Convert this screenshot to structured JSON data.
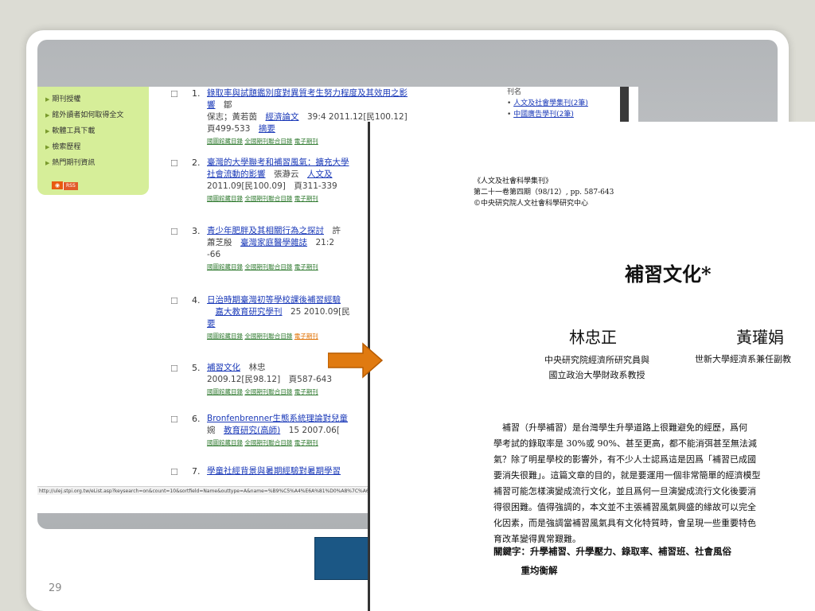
{
  "slide": {
    "page_number": "29"
  },
  "sidebar": {
    "items": [
      "期刊授權",
      "館外讀者如何取得全文",
      "軟體工具下載",
      "檢索歷程",
      "熱門期刊資訊"
    ],
    "rss_label": "RSS"
  },
  "right_col": {
    "heading": "刊名",
    "items": [
      "人文及社會學集刊(2筆)",
      "中國廣告學刊(2筆)"
    ]
  },
  "results": [
    {
      "n": "1.",
      "title": "錄取率與試題鑑別度對異質考生努力程度及其效用之影響",
      "authors_pre": "鄒",
      "authors": "保志；黃若茵",
      "journal": "經濟論文",
      "citation": "39:4 2011.12[民100.12]　頁499-533",
      "summary": "摘要"
    },
    {
      "n": "2.",
      "title": "臺灣的大學聯考和補習風氣：擴充大學",
      "title2": "社會流動的影響",
      "authors": "張瀞云",
      "journal": "人文及",
      "citation": "2011.09[民100.09]　頁311-339"
    },
    {
      "n": "3.",
      "title": "青少年肥胖及其相關行為之探討",
      "authors_pre": "許",
      "authors": "蕭芝殷",
      "journal": "臺灣家庭醫學雜誌",
      "citation": "21:2",
      "citation2": "-66"
    },
    {
      "n": "4.",
      "title": "日治時期臺灣初等學校課後補習經驗",
      "journal": "嘉大教育研究學刊",
      "citation": "25 2010.09[民",
      "summary": "要"
    },
    {
      "n": "5.",
      "title": "補習文化",
      "authors": "林忠",
      "citation": "2009.12[民98.12]　頁587-643"
    },
    {
      "n": "6.",
      "title": "Bronfenbrenner生態系統理論對兒童",
      "authors": "婉",
      "journal": "教育研究(高師)",
      "citation": "15 2007.06["
    },
    {
      "n": "7.",
      "title": "學童社經背景與暑期經驗對暑期學習"
    }
  ],
  "sublinks": {
    "a": "國圖館藏目錄",
    "b": "全國期刊聯合目錄",
    "c": "電子期刊",
    "c2": "電子期刊"
  },
  "status_url": "http://ulej.stpi.org.tw/eList.asp?keysearch=on&count=10&sortfield=Name&outtype=A&name=%B9%C5%A4%E6A%81%D0%A8%7C%A6",
  "document": {
    "meta": [
      "《人文及社會科學集刊》",
      "第二十一卷第四期（98/12）, pp. 587-643",
      "©中央研究院人文社會科學研究中心"
    ],
    "title": "補習文化*",
    "author1": "林忠正",
    "author2": "黃瓘娟",
    "aff1_line1": "中央研究院經濟所研究員與",
    "aff1_line2": "國立政治大學財政系教授",
    "aff2": "世新大學經濟系兼任副教",
    "abstract": [
      "　補習（升學補習）是台灣學生升學道路上很難避免的經歷，爲何",
      "學考試的錄取率是 30%或 90%、甚至更高，都不能消弭甚至無法減",
      "氣？除了明星學校的影響外，有不少人士認爲這是因爲「補習已成國",
      "要消失很難」。這篇文章的目的，就是要運用一個非常簡單的經濟模型",
      "補習可能怎樣演變成流行文化，並且爲何一旦演變成流行文化後要消",
      "得很困難。值得強調的，本文並不主張補習風氣興盛的緣故可以完全",
      "化因素，而是強調當補習風氣具有文化特質時，會呈現一些重要特色",
      "育改革變得異常艱難。"
    ],
    "keywords_line1": "關鍵字：升學補習、升學壓力、錄取率、補習班、社會風俗",
    "keywords_line2": "　　　重均衡解"
  },
  "colors": {
    "arrow": "#e07a10",
    "doc_border": "#333333",
    "blue_box": "#1b5785"
  }
}
